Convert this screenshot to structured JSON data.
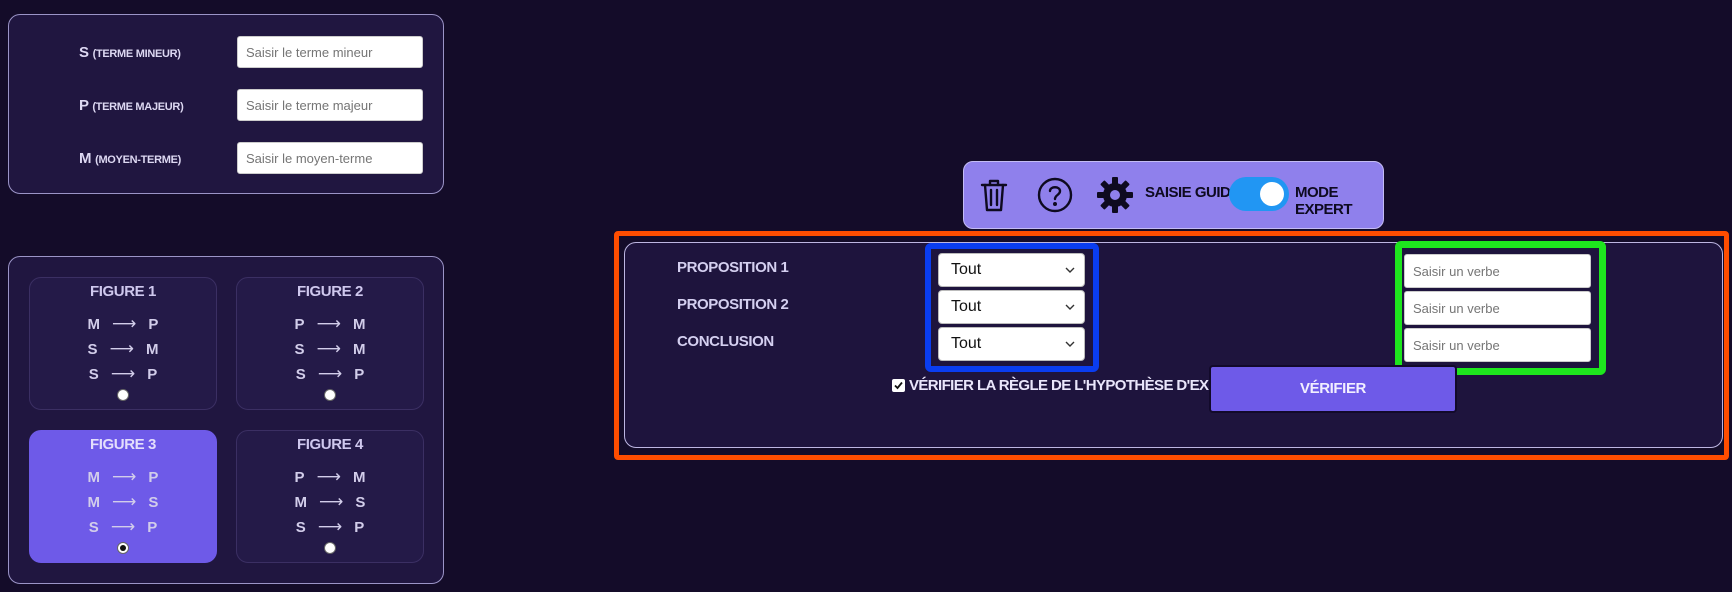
{
  "terms": {
    "rows": [
      {
        "letter": "S",
        "hint": "(terme mineur)",
        "placeholder": "Saisir le terme mineur"
      },
      {
        "letter": "P",
        "hint": "(terme majeur)",
        "placeholder": "Saisir le terme majeur"
      },
      {
        "letter": "M",
        "hint": "(moyen-terme)",
        "placeholder": "Saisir le moyen-terme"
      }
    ]
  },
  "figures": [
    {
      "title": "Figure 1",
      "lines": [
        [
          "M",
          "P"
        ],
        [
          "S",
          "M"
        ],
        [
          "S",
          "P"
        ]
      ],
      "selected": false
    },
    {
      "title": "Figure 2",
      "lines": [
        [
          "P",
          "M"
        ],
        [
          "S",
          "M"
        ],
        [
          "S",
          "P"
        ]
      ],
      "selected": false
    },
    {
      "title": "Figure 3",
      "lines": [
        [
          "M",
          "P"
        ],
        [
          "M",
          "S"
        ],
        [
          "S",
          "P"
        ]
      ],
      "selected": true
    },
    {
      "title": "Figure 4",
      "lines": [
        [
          "P",
          "M"
        ],
        [
          "M",
          "S"
        ],
        [
          "S",
          "P"
        ]
      ],
      "selected": false
    }
  ],
  "arrow_glyph": "⟶",
  "toolbar": {
    "icons": [
      "trash-icon",
      "help-icon",
      "gear-icon"
    ],
    "guided_label": "Saisie guidée",
    "expert_label": "Mode expert",
    "toggle_on": true
  },
  "propositions": {
    "rows": [
      {
        "label": "Proposition 1",
        "quantifier": "Tout",
        "verb_placeholder": "Saisir un verbe"
      },
      {
        "label": "Proposition 2",
        "quantifier": "Tout",
        "verb_placeholder": "Saisir un verbe"
      },
      {
        "label": "Conclusion",
        "quantifier": "Tout",
        "verb_placeholder": "Saisir un verbe"
      }
    ],
    "existence_check_label": "Vérifier la règle de l'hypothèse d'existence",
    "existence_checked": true,
    "verify_label": "Vérifier"
  },
  "colors": {
    "background": "#140c29",
    "panel": "#201640",
    "accent": "#6e5ae8",
    "toolbar": "#8f80ec",
    "toggle": "#2196f3",
    "highlight_orange": "#ff4d00",
    "highlight_blue": "#0a3df0",
    "highlight_green": "#1ee61e"
  }
}
